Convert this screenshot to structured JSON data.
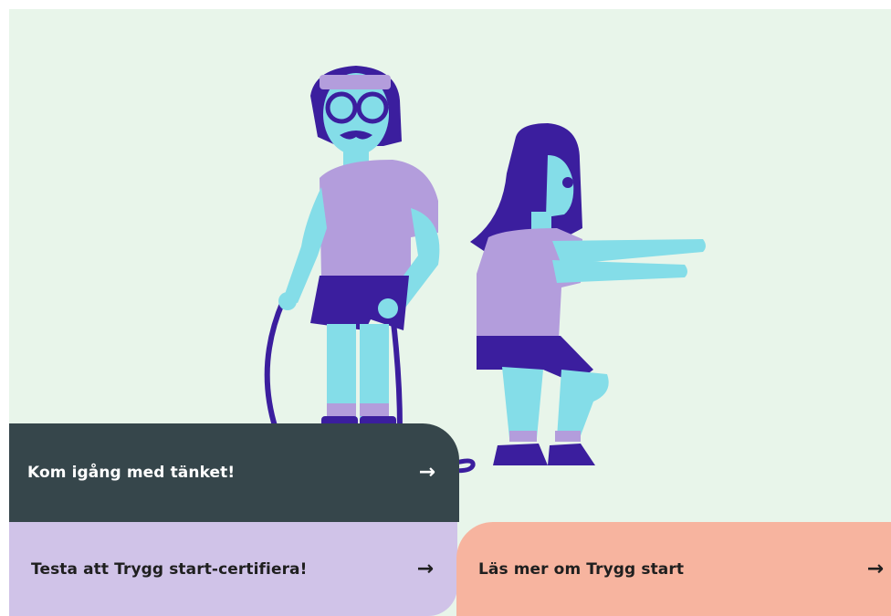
{
  "hero": {
    "illustration": "man-with-jump-rope-and-woman-squatting-illustration"
  },
  "links": [
    {
      "label": "Kom igång med tänket!",
      "icon": "arrow-right-icon"
    },
    {
      "label": "Testa att Trygg start-certifiera!",
      "icon": "arrow-right-icon"
    },
    {
      "label": "Läs mer om Trygg start",
      "icon": "arrow-right-icon"
    }
  ],
  "arrow_glyph": "→",
  "colors": {
    "background": "#e8f5ea",
    "dark_card": "#36464b",
    "lilac_card": "#d0c3e8",
    "salmon_card": "#f7b49f",
    "skin": "#84dde8",
    "shirt": "#b39ddc",
    "navy": "#3b1e9e"
  }
}
